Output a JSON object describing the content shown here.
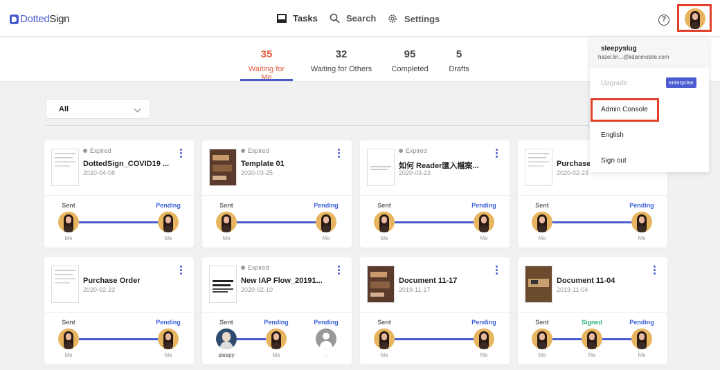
{
  "app": {
    "logo_dotted": "Dotted",
    "logo_sign": "Sign"
  },
  "nav": {
    "tasks": "Tasks",
    "search": "Search",
    "settings": "Settings",
    "help": "?"
  },
  "stats": [
    {
      "count": "35",
      "label": "Waiting for Me",
      "active": true
    },
    {
      "count": "32",
      "label": "Waiting for Others"
    },
    {
      "count": "95",
      "label": "Completed"
    },
    {
      "count": "5",
      "label": "Drafts"
    }
  ],
  "filter": {
    "selected": "All"
  },
  "cards": [
    {
      "status": "Expired",
      "title": "DottedSign_COVID19 ...",
      "date": "2020-04-08",
      "steps": [
        {
          "state": "Sent",
          "who": "Me"
        },
        {
          "state": "Pending",
          "who": "Me"
        }
      ]
    },
    {
      "status": "Expired",
      "title": "Template 01",
      "date": "2020-03-25",
      "steps": [
        {
          "state": "Sent",
          "who": "Me"
        },
        {
          "state": "Pending",
          "who": "Me"
        }
      ]
    },
    {
      "status": "Expired",
      "title": "如何 Reader匯入檔案...",
      "date": "2020-03-23",
      "steps": [
        {
          "state": "Sent",
          "who": "Me"
        },
        {
          "state": "Pending",
          "who": "Me"
        }
      ]
    },
    {
      "status": "",
      "title": "Purchase O",
      "date": "2020-02-23",
      "steps": [
        {
          "state": "Sent",
          "who": "Me"
        },
        {
          "state": "Pending",
          "who": "Me"
        }
      ]
    },
    {
      "status": "",
      "title": "Purchase Order",
      "date": "2020-02-23",
      "steps": [
        {
          "state": "Sent",
          "who": "Me"
        },
        {
          "state": "Pending",
          "who": "Me"
        }
      ]
    },
    {
      "status": "Expired",
      "title": "New IAP Flow_20191...",
      "date": "2020-02-10",
      "steps": [
        {
          "state": "Sent",
          "who": "sleepy"
        },
        {
          "state": "Pending",
          "who": "Me"
        },
        {
          "state": "Pending",
          "who": "-"
        }
      ]
    },
    {
      "status": "",
      "title": "Document 11-17",
      "date": "2019-11-17",
      "steps": [
        {
          "state": "Sent",
          "who": "Me"
        },
        {
          "state": "Pending",
          "who": "Me"
        }
      ]
    },
    {
      "status": "",
      "title": "Document 11-04",
      "date": "2019-11-04",
      "steps": [
        {
          "state": "Sent",
          "who": "Me"
        },
        {
          "state": "Signed",
          "who": "Me"
        },
        {
          "state": "Pending",
          "who": "Me"
        }
      ]
    }
  ],
  "menu": {
    "username": "sleepyslug",
    "email": "hazel.lin...@kdanmobile.com",
    "upgrade": "Upgrade",
    "badge": "enterprise",
    "admin_console": "Admin Console",
    "language": "English",
    "sign_out": "Sign out"
  },
  "colors": {
    "accent": "#4a5bd0",
    "active_stat": "#e25a3f",
    "pending": "#3a5fd8",
    "signed": "#2fb57d",
    "highlight": "#e0402a"
  }
}
